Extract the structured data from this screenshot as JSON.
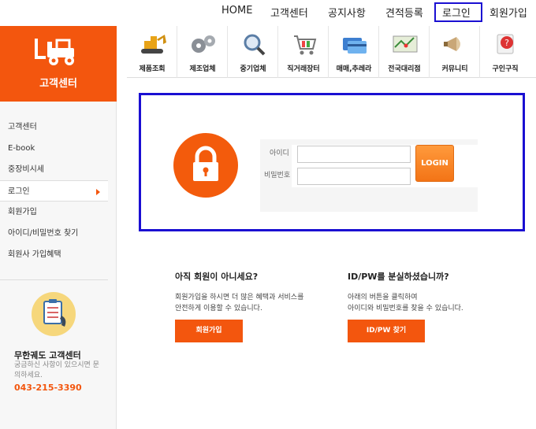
{
  "topnav": {
    "home": "HOME",
    "customer_center": "고객센터",
    "notice": "공지사항",
    "quote": "견적등록",
    "login": "로그인",
    "join": "회원가입"
  },
  "sidebar": {
    "brand_title": "고객센터",
    "items": [
      {
        "label": "고객센터"
      },
      {
        "label": "E-book"
      },
      {
        "label": "중장비시세"
      },
      {
        "label": "로그인"
      },
      {
        "label": "회원가입"
      },
      {
        "label": "아이디/비밀번호 찾기"
      },
      {
        "label": "회원사 가입혜택"
      }
    ],
    "cs_title": "무한궤도 고객센터",
    "cs_desc": "궁금하신 사항이 있으시면 문의하세요.",
    "cs_phone": "043-215-3390"
  },
  "categories": [
    {
      "label": "제품조회",
      "icon": "excavator-icon"
    },
    {
      "label": "제조업체",
      "icon": "gears-icon"
    },
    {
      "label": "중기업체",
      "icon": "magnifier-icon"
    },
    {
      "label": "직거래장터",
      "icon": "cart-icon"
    },
    {
      "label": "매매,추레라",
      "icon": "credit-card-icon"
    },
    {
      "label": "전국대리점",
      "icon": "map-icon"
    },
    {
      "label": "커뮤니티",
      "icon": "megaphone-icon"
    },
    {
      "label": "구인구직",
      "icon": "help-icon"
    }
  ],
  "login": {
    "id_label": "아이디",
    "pw_label": "비밀번호",
    "id_value": "",
    "pw_value": "",
    "button": "LOGIN"
  },
  "join_section": {
    "title": "아직 회원이 아니세요?",
    "desc_line1": "회원가입을 하시면 더 많은 혜택과 서비스를",
    "desc_line2": "안전하게 이용할 수 있습니다.",
    "button": "회원가입"
  },
  "find_section": {
    "title": "ID/PW를 분실하셨습니까?",
    "desc_line1": "아래의 버튼을 클릭하여",
    "desc_line2": "아이디와 비밀번호를 찾을 수 있습니다.",
    "button": "ID/PW 찾기"
  },
  "colors": {
    "accent": "#f3560e",
    "highlight_border": "#1a0fd2"
  }
}
